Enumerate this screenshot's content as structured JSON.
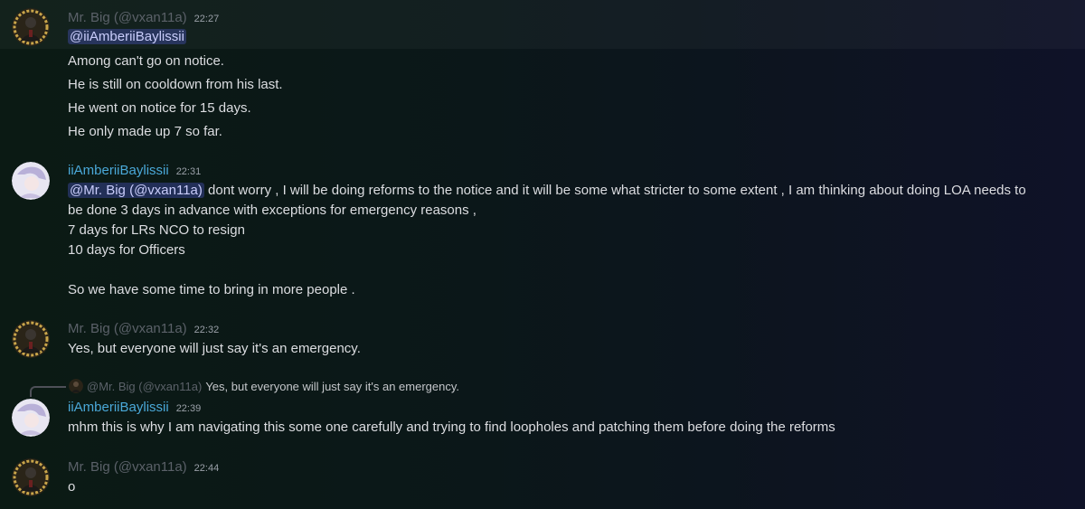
{
  "messages": [
    {
      "author": "Mr. Big (@vxan11a)",
      "time": "22:27",
      "mention": "@iiAmberiiBaylissii",
      "lines": [
        "Among can't go on notice.",
        "He is still on cooldown from his last.",
        "He went on notice for 15 days.",
        "He only made up 7 so far."
      ]
    },
    {
      "author": "iiAmberiiBaylissii",
      "time": "22:31",
      "mention": "@Mr. Big (@vxan11a)",
      "first_line_rest": " dont worry , I will be doing reforms to the notice and it will be some what stricter to some extent , I am thinking about doing LOA needs to",
      "lines": [
        "be done 3 days in advance with exceptions for emergency reasons ,",
        "7 days for LRs NCO to resign",
        "10 days for Officers",
        "So we have some time to bring in more people ."
      ]
    },
    {
      "author": "Mr. Big (@vxan11a)",
      "time": "22:32",
      "lines": [
        "Yes, but everyone will just say it's an emergency."
      ]
    },
    {
      "reply_author": "@Mr. Big (@vxan11a)",
      "reply_text": "Yes, but everyone will just say it's an emergency.",
      "author": "iiAmberiiBaylissii",
      "time": "22:39",
      "lines": [
        "mhm this is why I am navigating this some one carefully and trying to find loopholes and patching them before doing the reforms"
      ]
    },
    {
      "author": "Mr. Big (@vxan11a)",
      "time": "22:44",
      "lines": [
        "o"
      ]
    }
  ],
  "icons": {
    "mr_big_avatar": "avatar-icon-gold-laurel",
    "amber_avatar": "avatar-icon-anime"
  },
  "colors": {
    "muted_name": "#5b6169",
    "blue_name": "#4aa8d8",
    "mention_bg": "#5865f2"
  }
}
